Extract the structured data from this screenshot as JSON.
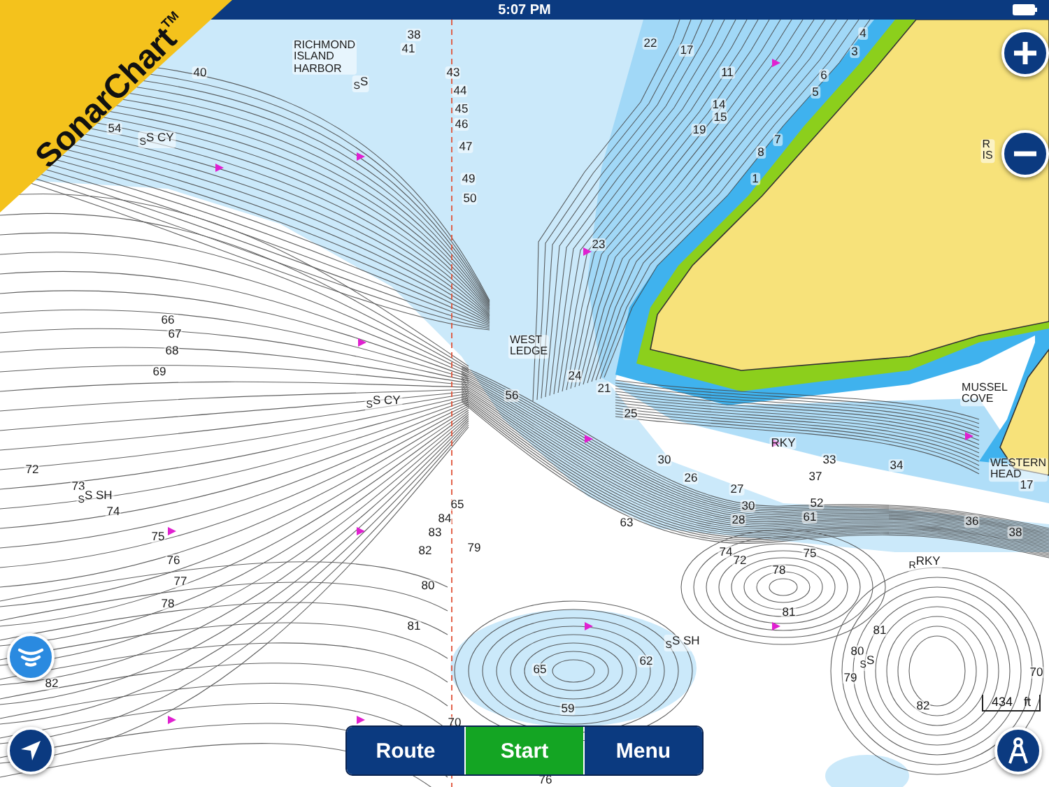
{
  "status_bar": {
    "time": "5:07 PM"
  },
  "banner": {
    "text": "SonarChart$^{TM}$"
  },
  "chart": {
    "labels": [
      {
        "kind": "depth",
        "text": "38"
      },
      {
        "kind": "depth",
        "text": "41"
      },
      {
        "kind": "depth",
        "text": "40"
      },
      {
        "kind": "place",
        "lines": [
          "RICHMOND",
          "ISLAND",
          "HARBOR"
        ]
      },
      {
        "kind": "seabed",
        "text": "$_{S}$S"
      },
      {
        "kind": "depth",
        "text": "43"
      },
      {
        "kind": "depth",
        "text": "44"
      },
      {
        "kind": "depth",
        "text": "45"
      },
      {
        "kind": "depth",
        "text": "46"
      },
      {
        "kind": "depth",
        "text": "47"
      },
      {
        "kind": "depth",
        "text": "49"
      },
      {
        "kind": "depth",
        "text": "50"
      },
      {
        "kind": "depth",
        "text": "54"
      },
      {
        "kind": "seabed",
        "text": "$_{S}$S CY"
      },
      {
        "kind": "depth",
        "text": "22"
      },
      {
        "kind": "depth",
        "text": "17"
      },
      {
        "kind": "depth",
        "text": "11"
      },
      {
        "kind": "depth",
        "text": "14"
      },
      {
        "kind": "depth",
        "text": "15"
      },
      {
        "kind": "depth",
        "text": "19"
      },
      {
        "kind": "depth",
        "text": "6"
      },
      {
        "kind": "depth",
        "text": "5"
      },
      {
        "kind": "depth",
        "text": "4"
      },
      {
        "kind": "depth",
        "text": "3"
      },
      {
        "kind": "depth",
        "text": "7"
      },
      {
        "kind": "depth",
        "text": "8"
      },
      {
        "kind": "depth",
        "text": "1"
      },
      {
        "kind": "depth",
        "text": "23"
      },
      {
        "kind": "place",
        "lines": [
          "R",
          "IS"
        ]
      },
      {
        "kind": "depth",
        "text": "66"
      },
      {
        "kind": "depth",
        "text": "67"
      },
      {
        "kind": "depth",
        "text": "68"
      },
      {
        "kind": "depth",
        "text": "69"
      },
      {
        "kind": "place",
        "lines": [
          "WEST",
          "LEDGE"
        ]
      },
      {
        "kind": "depth",
        "text": "56"
      },
      {
        "kind": "depth",
        "text": "24"
      },
      {
        "kind": "depth",
        "text": "21"
      },
      {
        "kind": "depth",
        "text": "25"
      },
      {
        "kind": "seabed",
        "text": "$_{S}$S CY"
      },
      {
        "kind": "depth",
        "text": "72"
      },
      {
        "kind": "depth",
        "text": "73"
      },
      {
        "kind": "seabed",
        "text": "$_{S}$S SH"
      },
      {
        "kind": "depth",
        "text": "74"
      },
      {
        "kind": "depth",
        "text": "65"
      },
      {
        "kind": "depth",
        "text": "84"
      },
      {
        "kind": "depth",
        "text": "83"
      },
      {
        "kind": "depth",
        "text": "82"
      },
      {
        "kind": "depth",
        "text": "79"
      },
      {
        "kind": "depth",
        "text": "80"
      },
      {
        "kind": "depth",
        "text": "81"
      },
      {
        "kind": "depth",
        "text": "75"
      },
      {
        "kind": "depth",
        "text": "76"
      },
      {
        "kind": "depth",
        "text": "77"
      },
      {
        "kind": "depth",
        "text": "78"
      },
      {
        "kind": "depth",
        "text": "82"
      },
      {
        "kind": "depth",
        "text": "30"
      },
      {
        "kind": "depth",
        "text": "26"
      },
      {
        "kind": "depth",
        "text": "27"
      },
      {
        "kind": "depth",
        "text": "30"
      },
      {
        "kind": "depth",
        "text": "63"
      },
      {
        "kind": "depth",
        "text": "28"
      },
      {
        "kind": "depth",
        "text": "52"
      },
      {
        "kind": "depth",
        "text": "61"
      },
      {
        "kind": "depth",
        "text": "33"
      },
      {
        "kind": "depth",
        "text": "37"
      },
      {
        "kind": "depth",
        "text": "34"
      },
      {
        "kind": "seabed",
        "text": "RKY"
      },
      {
        "kind": "place",
        "lines": [
          "MUSSEL",
          "COVE"
        ]
      },
      {
        "kind": "place",
        "lines": [
          "WESTERN",
          "HEAD"
        ]
      },
      {
        "kind": "depth",
        "text": "17"
      },
      {
        "kind": "depth",
        "text": "36"
      },
      {
        "kind": "depth",
        "text": "38"
      },
      {
        "kind": "depth",
        "text": "74"
      },
      {
        "kind": "depth",
        "text": "72"
      },
      {
        "kind": "depth",
        "text": "75"
      },
      {
        "kind": "depth",
        "text": "78"
      },
      {
        "kind": "seabed",
        "text": "$_{R}$RKY"
      },
      {
        "kind": "depth",
        "text": "81"
      },
      {
        "kind": "seabed",
        "text": "$_{S}$S SH"
      },
      {
        "kind": "depth",
        "text": "62"
      },
      {
        "kind": "depth",
        "text": "65"
      },
      {
        "kind": "depth",
        "text": "59"
      },
      {
        "kind": "depth",
        "text": "81"
      },
      {
        "kind": "depth",
        "text": "80"
      },
      {
        "kind": "seabed",
        "text": "$_{S}$S"
      },
      {
        "kind": "depth",
        "text": "79"
      },
      {
        "kind": "depth",
        "text": "82"
      },
      {
        "kind": "depth",
        "text": "70"
      },
      {
        "kind": "depth",
        "text": "70"
      },
      {
        "kind": "depth",
        "text": "76"
      }
    ]
  },
  "scale_bar": {
    "value": "434",
    "unit": "ft"
  },
  "bottom_bar": [
    {
      "label": "Route",
      "selected": false
    },
    {
      "label": "Start",
      "selected": true
    },
    {
      "label": "Menu",
      "selected": false
    }
  ]
}
